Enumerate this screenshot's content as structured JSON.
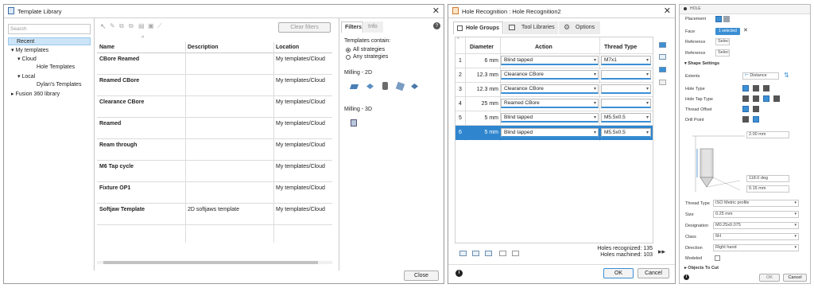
{
  "template_library": {
    "title": "Template Library",
    "search_placeholder": "Search",
    "tree": [
      "Recent",
      "My templates",
      "Cloud",
      "Hole Templates",
      "Local",
      "Dylan's Templates",
      "Fusion 360 library"
    ],
    "clear_filters": "Clear filters",
    "columns": [
      "Name",
      "Description",
      "Location"
    ],
    "rows": [
      {
        "name": "CBore Reamed",
        "description": "",
        "location": "My templates/Cloud"
      },
      {
        "name": "Reamed CBore",
        "description": "",
        "location": "My templates/Cloud"
      },
      {
        "name": "Clearance CBore",
        "description": "",
        "location": "My templates/Cloud"
      },
      {
        "name": "Reamed",
        "description": "",
        "location": "My templates/Cloud"
      },
      {
        "name": "Ream through",
        "description": "",
        "location": "My templates/Cloud"
      },
      {
        "name": "M6 Tap cycle",
        "description": "",
        "location": "My templates/Cloud"
      },
      {
        "name": "Fixture OP1",
        "description": "",
        "location": "My templates/Cloud"
      },
      {
        "name": "Softjaw Template",
        "description": "2D softjaws template",
        "location": "My templates/Cloud"
      }
    ],
    "filters_tab": "Filters",
    "info_tab": "Info",
    "templates_contain": "Templates contain:",
    "all_strategies": "All strategies",
    "any_strategies": "Any strategies",
    "milling_2d": "Milling - 2D",
    "milling_3d": "Milling - 3D",
    "close": "Close"
  },
  "hole_recognition": {
    "title": "Hole Recognition : Hole Recognition2",
    "tabs": [
      "Hole Groups",
      "Tool Libraries",
      "Options"
    ],
    "columns": [
      "Diameter",
      "Action",
      "Thread Type"
    ],
    "rows": [
      {
        "num": "1",
        "diameter": "6 mm",
        "action": "Blind tapped",
        "thread": "M7x1"
      },
      {
        "num": "2",
        "diameter": "12.3 mm",
        "action": "Clearance CBore",
        "thread": ""
      },
      {
        "num": "3",
        "diameter": "12.3 mm",
        "action": "Clearance CBore",
        "thread": ""
      },
      {
        "num": "4",
        "diameter": "25 mm",
        "action": "Reamed CBore",
        "thread": ""
      },
      {
        "num": "5",
        "diameter": "5 mm",
        "action": "Blind tapped",
        "thread": "M5.5x0.5"
      },
      {
        "num": "6",
        "diameter": "5 mm",
        "action": "Blind tapped",
        "thread": "M5.5x0.5"
      }
    ],
    "holes_recognized": "Holes recognized: 135",
    "holes_machined": "Holes machined: 103",
    "ok": "OK",
    "cancel": "Cancel"
  },
  "hole_panel": {
    "title": "HOLE",
    "placement": "Placement",
    "face": "Face",
    "face_value": "1 selected",
    "reference1": "Reference",
    "reference2": "Reference",
    "select1": "Select",
    "select2": "Select",
    "shape_settings": "Shape Settings",
    "extents": "Extents",
    "extents_value": "Distance",
    "hole_type": "Hole Type",
    "hole_tap_type": "Hole Tap Type",
    "thread_offset": "Thread Offset",
    "drill_point": "Drill Point",
    "dim_top": "2.00 mm",
    "dim_angle": "118.0 deg",
    "dim_depth": "0.15 mm",
    "thread_type_label": "Thread Type",
    "thread_type_value": "ISO Metric profile",
    "size_label": "Size",
    "size_value": "0.25 mm",
    "designation_label": "Designation",
    "designation_value": "M0.25x0.075",
    "class_label": "Class",
    "class_value": "6H",
    "direction_label": "Direction",
    "direction_value": "Right hand",
    "modeled_label": "Modeled",
    "objects_to_cut": "Objects To Cut",
    "ok": "OK",
    "cancel": "Cancel"
  }
}
